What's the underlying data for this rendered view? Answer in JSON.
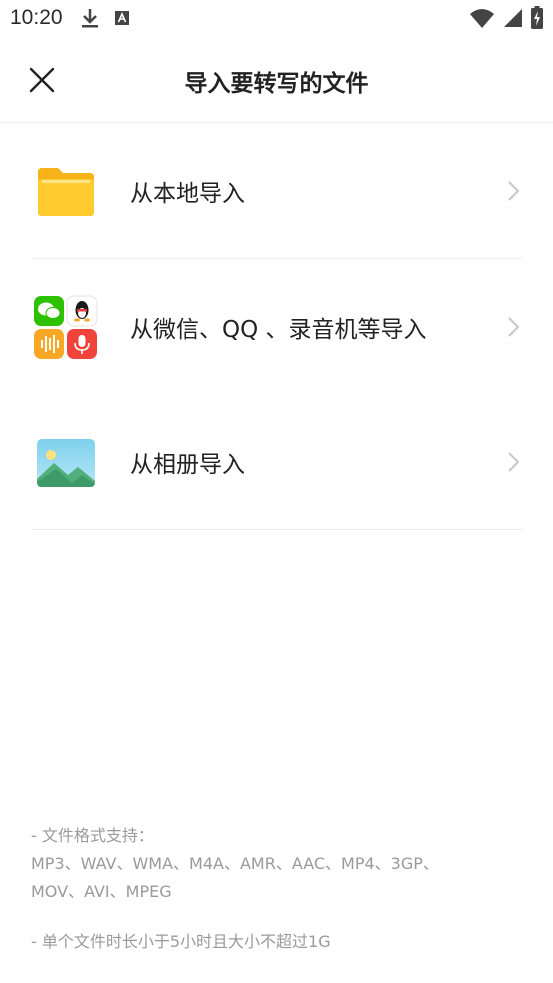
{
  "status_bar": {
    "time": "10:20"
  },
  "header": {
    "title": "导入要转写的文件"
  },
  "options": [
    {
      "label": "从本地导入",
      "icon": "folder-icon"
    },
    {
      "label": "从微信、QQ 、录音机等导入",
      "icon": "app-grid-icon"
    },
    {
      "label": "从相册导入",
      "icon": "gallery-icon"
    }
  ],
  "notes": {
    "format_heading": "- 文件格式支持：",
    "formats_line1": "MP3、WAV、WMA、M4A、AMR、AAC、MP4、3GP、",
    "formats_line2": "MOV、AVI、MPEG",
    "limit": "- 单个文件时长小于5小时且大小不超过1G"
  },
  "colors": {
    "folder": "#FFC928",
    "wechat": "#2DC100",
    "recorder_orange": "#F9A825",
    "recorder_red": "#F0433A",
    "gallery_sky": "#7EC8E9",
    "gallery_hill": "#4FB07B"
  }
}
